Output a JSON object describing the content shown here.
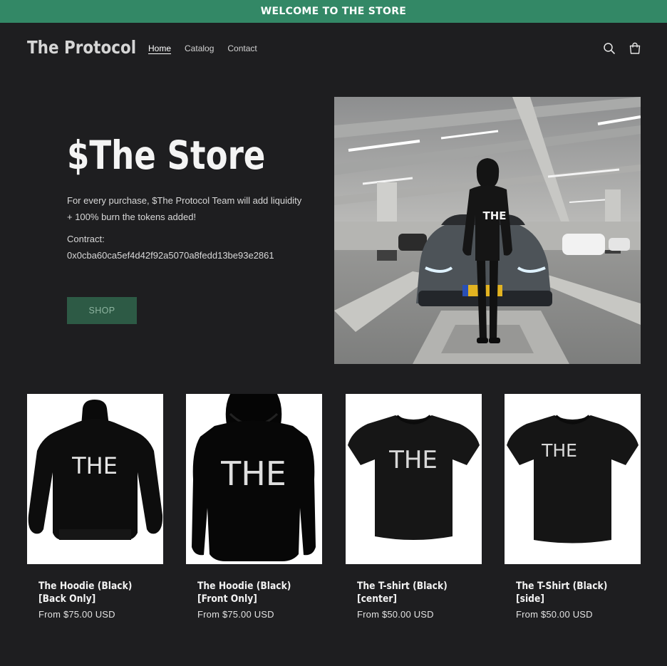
{
  "announcement": "WELCOME TO THE STORE",
  "header": {
    "logo": "The Protocol",
    "nav": [
      {
        "label": "Home",
        "active": true
      },
      {
        "label": "Catalog",
        "active": false
      },
      {
        "label": "Contact",
        "active": false
      }
    ],
    "icons": [
      "search-icon",
      "cart-icon"
    ]
  },
  "hero": {
    "title": "$The Store",
    "description": "For every purchase, $The Protocol Team will add liquidity + 100% burn the tokens added!",
    "contract_label": "Contract:",
    "contract_address": "0x0cba60ca5ef4d42f92a5070a8fedd13be93e2861",
    "button": "SHOP",
    "image_text": "THE"
  },
  "products": [
    {
      "title": "The Hoodie (Black) [Back Only]",
      "price": "From $75.00 USD",
      "print": "THE"
    },
    {
      "title": "The Hoodie (Black) [Front Only]",
      "price": "From $75.00 USD",
      "print": "THE"
    },
    {
      "title": "The T-shirt (Black) [center]",
      "price": "From $50.00 USD",
      "print": "THE"
    },
    {
      "title": "The T-Shirt (Black) [side]",
      "price": "From $50.00 USD",
      "print": "THE"
    }
  ],
  "colors": {
    "announcement_bg": "#338866",
    "page_bg": "#1e1e20",
    "button_bg": "#2d5a45"
  }
}
